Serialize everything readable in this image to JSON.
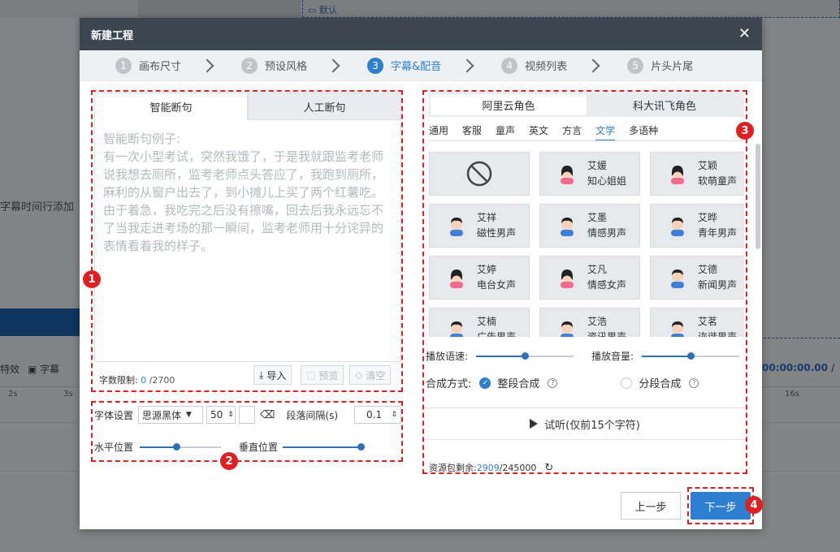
{
  "background": {
    "default_label": "默认",
    "row_text": "字幕时间行添加",
    "tools": [
      {
        "label": "特效",
        "x": 0
      },
      {
        "label": "字幕",
        "x": 52
      }
    ],
    "timecode": "00:00:00.00 /",
    "ruler": [
      "2s",
      "3s",
      "16s"
    ]
  },
  "dialog": {
    "title": "新建工程",
    "steps": [
      {
        "num": "1",
        "label": "画布尺寸"
      },
      {
        "num": "2",
        "label": "预设风格"
      },
      {
        "num": "3",
        "label": "字幕&配音"
      },
      {
        "num": "4",
        "label": "视频列表"
      },
      {
        "num": "5",
        "label": "片头片尾"
      }
    ],
    "active_step": 3
  },
  "left": {
    "tabs": [
      "智能断句",
      "人工断句"
    ],
    "placeholder": "智能断句例子:\n有一次小型考试，突然我饿了，于是我就跟监考老师说我想去厕所，监考老师点头答应了，我跑到厕所，麻利的从窗户出去了，到小摊儿上买了两个红薯吃。由于着急，我吃完之后没有擦嘴，回去后我永远忘不了当我走进考场的那一瞬间，监考老师用十分诧异的表情看着我的样子。",
    "count_label": "字数限制:",
    "count_value": "0",
    "count_total": "/2700",
    "buttons": {
      "import": "导入",
      "preview": "预览",
      "clear": "清空"
    },
    "font_label": "字体设置",
    "font_value": "思源黑体",
    "size_value": "50",
    "para_label": "段落间隔(s)",
    "para_value": "0.1",
    "hpos_label": "水平位置",
    "vpos_label": "垂直位置",
    "hpos_value": 0.45,
    "vpos_value": 0.96
  },
  "right": {
    "tabs": [
      "阿里云角色",
      "科大讯飞角色"
    ],
    "categories": [
      "通用",
      "客服",
      "童声",
      "英文",
      "方言",
      "文学",
      "多语种"
    ],
    "active_category": 5,
    "voices": [
      {
        "name": "",
        "desc": "",
        "gender": "none"
      },
      {
        "name": "艾媛",
        "desc": "知心姐姐",
        "gender": "f"
      },
      {
        "name": "艾颖",
        "desc": "软萌童声",
        "gender": "f"
      },
      {
        "name": "艾祥",
        "desc": "磁性男声",
        "gender": "m"
      },
      {
        "name": "艾墨",
        "desc": "情感男声",
        "gender": "m"
      },
      {
        "name": "艾晔",
        "desc": "青年男声",
        "gender": "m"
      },
      {
        "name": "艾婷",
        "desc": "电台女声",
        "gender": "f"
      },
      {
        "name": "艾凡",
        "desc": "情感女声",
        "gender": "f"
      },
      {
        "name": "艾德",
        "desc": "新闻男声",
        "gender": "m"
      },
      {
        "name": "艾楠",
        "desc": "广告男声",
        "gender": "m"
      },
      {
        "name": "艾浩",
        "desc": "资讯男声",
        "gender": "m"
      },
      {
        "name": "艾茗",
        "desc": "诙谐男声",
        "gender": "m"
      }
    ],
    "speed_label": "播放语速:",
    "volume_label": "播放音量:",
    "speed_value": 0.5,
    "volume_value": 0.5,
    "mode_label": "合成方式:",
    "mode_whole": "整段合成",
    "mode_segment": "分段合成",
    "trial_label": "试听(仅前15个字符)",
    "res_label": "资源包剩余:",
    "res_used": "2909",
    "res_total": "/245000"
  },
  "footer": {
    "prev": "上一步",
    "next": "下一步"
  },
  "markers": [
    "1",
    "2",
    "3",
    "4"
  ],
  "colors": {
    "accent": "#2f7fd0",
    "annotation": "#e02020",
    "titlebar": "#3c4650"
  }
}
